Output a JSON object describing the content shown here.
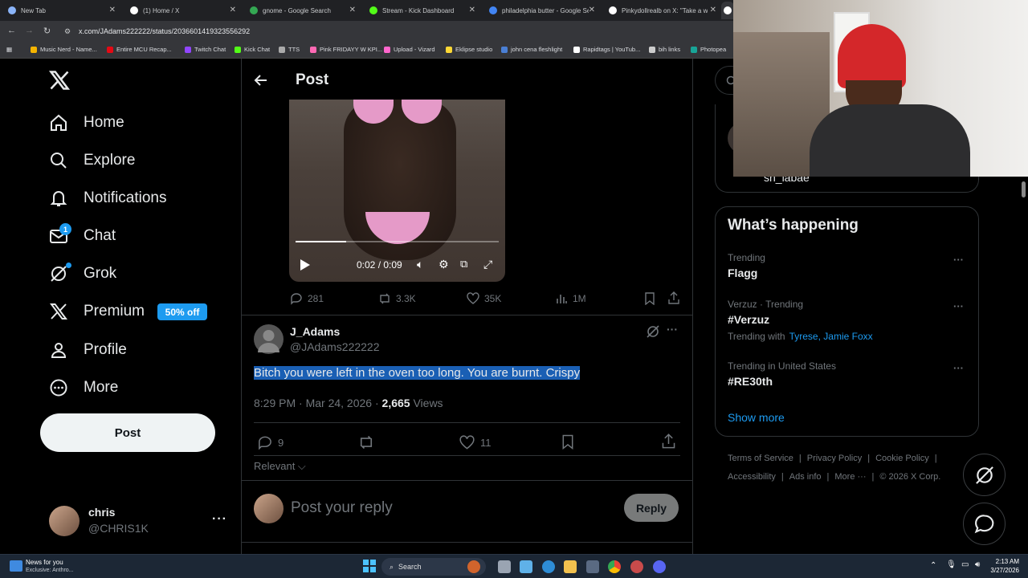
{
  "browser": {
    "tabs": [
      {
        "title": "New Tab",
        "color": "#8ab4f8"
      },
      {
        "title": "(1) Home / X",
        "color": "#ffffff"
      },
      {
        "title": "gnome - Google Search",
        "color": "#34a853"
      },
      {
        "title": "Stream - Kick Dashboard",
        "color": "#53fc18"
      },
      {
        "title": "philadelphia butter - Google Se",
        "color": "#4285f4"
      },
      {
        "title": "Pinkydollrealb on X: \"Take a w",
        "color": "#ffffff"
      }
    ],
    "url": "x.com/JAdams222222/status/2036601419323556292",
    "bookmarks": [
      "Music Nerd - Name...",
      "Entire MCU Recap...",
      "Twitch Chat",
      "Kick Chat",
      "TTS",
      "Pink FRIDAYY W KPI...",
      "Upload - Vizard",
      "Eklipse studio",
      "john cena fleshlight",
      "Rapidtags | YouTub...",
      "bih links",
      "Photopea"
    ]
  },
  "sidebar": {
    "items": [
      {
        "label": "Home",
        "icon": "home-icon"
      },
      {
        "label": "Explore",
        "icon": "search-icon"
      },
      {
        "label": "Notifications",
        "icon": "bell-icon"
      },
      {
        "label": "Chat",
        "icon": "mail-icon"
      },
      {
        "label": "Grok",
        "icon": "grok-icon"
      },
      {
        "label": "Premium",
        "icon": "x-logo-icon"
      },
      {
        "label": "Profile",
        "icon": "person-icon"
      },
      {
        "label": "More",
        "icon": "more-circle-icon"
      }
    ],
    "chat_badge": "1",
    "premium_badge": "50% off",
    "post_button": "Post",
    "account": {
      "name": "chris",
      "handle": "@CHRIS1K"
    }
  },
  "header": {
    "title": "Post"
  },
  "video": {
    "time": "0:02 / 0:09",
    "progress": 0.25
  },
  "parent_stats": {
    "replies": "281",
    "reposts": "3.3K",
    "likes": "35K",
    "views": "1M"
  },
  "reply_post": {
    "author": "J_Adams",
    "handle": "@JAdams222222",
    "text": "Bitch you were left in the oven too long. You are burnt. Crispy",
    "timestamp": "8:29 PM · Mar 24, 2026 · ",
    "views_count": "2,665",
    "views_label": " Views",
    "replies": "9",
    "likes": "11"
  },
  "sort_label": "Relevant",
  "composer": {
    "placeholder": "Post your reply",
    "button": "Reply"
  },
  "right": {
    "partial_name": "sh_labae",
    "happening_title": "What’s happening",
    "trends": [
      {
        "context": "Trending",
        "name": "Flagg"
      },
      {
        "context": "Verzuz · Trending",
        "name": "#Verzuz",
        "with_label": "Trending with",
        "with_links": "Tyrese, Jamie Foxx"
      },
      {
        "context": "Trending in United States",
        "name": "#RE30th"
      }
    ],
    "show_more": "Show more",
    "footer_line1": [
      "Terms of Service",
      "Privacy Policy",
      "Cookie Policy"
    ],
    "footer_line2": [
      "Accessibility",
      "Ads info",
      "More ···",
      "© 2026 X Corp."
    ]
  },
  "taskbar": {
    "news_title": "News for you",
    "news_sub": "Exclusive: Anthro...",
    "search": "Search",
    "time": "2:13 AM",
    "date": "3/27/2026"
  }
}
